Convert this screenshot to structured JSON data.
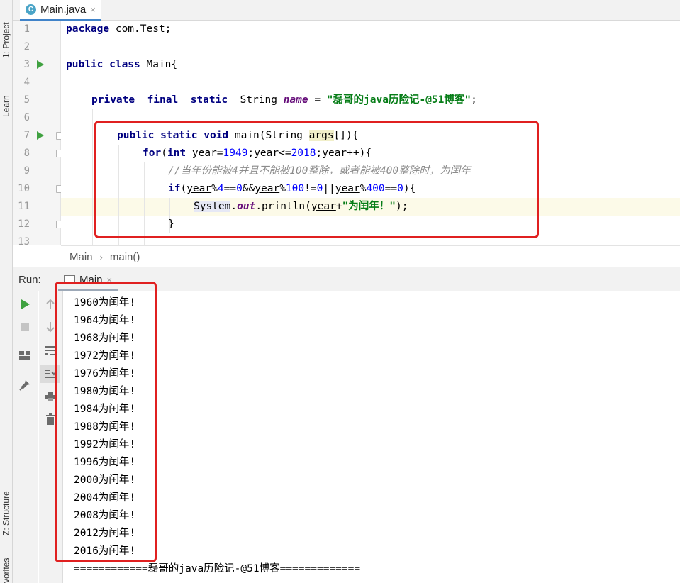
{
  "sidebar": {
    "project_tab": "1: Project",
    "learn_tab": "Learn",
    "structure_tab": "Z: Structure",
    "favorites_tab": "vorites"
  },
  "editor": {
    "tab_title": "Main.java",
    "tab_icon_letter": "C",
    "tab_close": "×",
    "line_numbers": [
      "1",
      "2",
      "3",
      "4",
      "5",
      "6",
      "7",
      "8",
      "9",
      "10",
      "11",
      "12",
      "13"
    ],
    "code": {
      "l1_kw": "package",
      "l1_rest": " com.Test;",
      "l3_kw": "public class",
      "l3_rest": " Main{",
      "l5_kw1": "private",
      "l5_kw2": "final",
      "l5_kw3": "static",
      "l5_type": "String",
      "l5_field": "name",
      "l5_eq": " = ",
      "l5_str": "\"磊哥的java历险记-@51博客\"",
      "l5_end": ";",
      "l7_kw": "public static void",
      "l7_main": " main(String ",
      "l7_args": "args",
      "l7_end": "[]){",
      "l8_kw": "for",
      "l8_open": "(",
      "l8_int": "int",
      "l8_sp": " ",
      "l8_year1": "year",
      "l8_eq": "=",
      "l8_n1": "1949",
      "l8_semi1": ";",
      "l8_year2": "year",
      "l8_le": "<=",
      "l8_n2": "2018",
      "l8_semi2": ";",
      "l8_year3": "year",
      "l8_end": "++){",
      "l9_comment": "//当年份能被4并且不能被100整除，或者能被400整除时，为闰年",
      "l10_kw": "if",
      "l10_open": "(",
      "l10_y1": "year",
      "l10_m1": "%",
      "l10_n4": "4",
      "l10_eq1": "==",
      "l10_z1": "0",
      "l10_and": "&&",
      "l10_y2": "year",
      "l10_m2": "%",
      "l10_n100": "100",
      "l10_ne": "!=",
      "l10_z2": "0",
      "l10_or": "||",
      "l10_y3": "year",
      "l10_m3": "%",
      "l10_n400": "400",
      "l10_eq3": "==",
      "l10_z3": "0",
      "l10_end": "){",
      "l11_sys": "System",
      "l11_dot1": ".",
      "l11_out": "out",
      "l11_println": ".println(",
      "l11_year": "year",
      "l11_plus": "+",
      "l11_str": "\"为闰年！\"",
      "l11_end": ");",
      "l12": "}"
    }
  },
  "breadcrumb": {
    "class_name": "Main",
    "separator": "›",
    "method_name": "main()"
  },
  "run": {
    "label": "Run:",
    "tab_title": "Main",
    "tab_close": "×",
    "output": [
      "1960为闰年!",
      "1964为闰年!",
      "1968为闰年!",
      "1972为闰年!",
      "1976为闰年!",
      "1980为闰年!",
      "1984为闰年!",
      "1988为闰年!",
      "1992为闰年!",
      "1996为闰年!",
      "2000为闰年!",
      "2004为闰年!",
      "2008为闰年!",
      "2012为闰年!",
      "2016为闰年!"
    ],
    "footer_line": "============磊哥的java历险记-@51博客============="
  },
  "colors": {
    "keyword": "#000080",
    "string": "#067d17",
    "number": "#0000ff",
    "comment": "#8c8c8c",
    "field": "#660e7a",
    "annotation_red": "#e02020",
    "run_green": "#3fa140"
  },
  "icons": [
    "class-icon",
    "run-gutter-icon",
    "fold-icon",
    "bulb-icon",
    "rerun-icon",
    "stop-icon",
    "layout-icon",
    "pin-icon",
    "up-arrow-icon",
    "down-arrow-icon",
    "soft-wrap-icon",
    "scroll-end-icon",
    "print-icon",
    "trash-icon",
    "console-icon"
  ]
}
